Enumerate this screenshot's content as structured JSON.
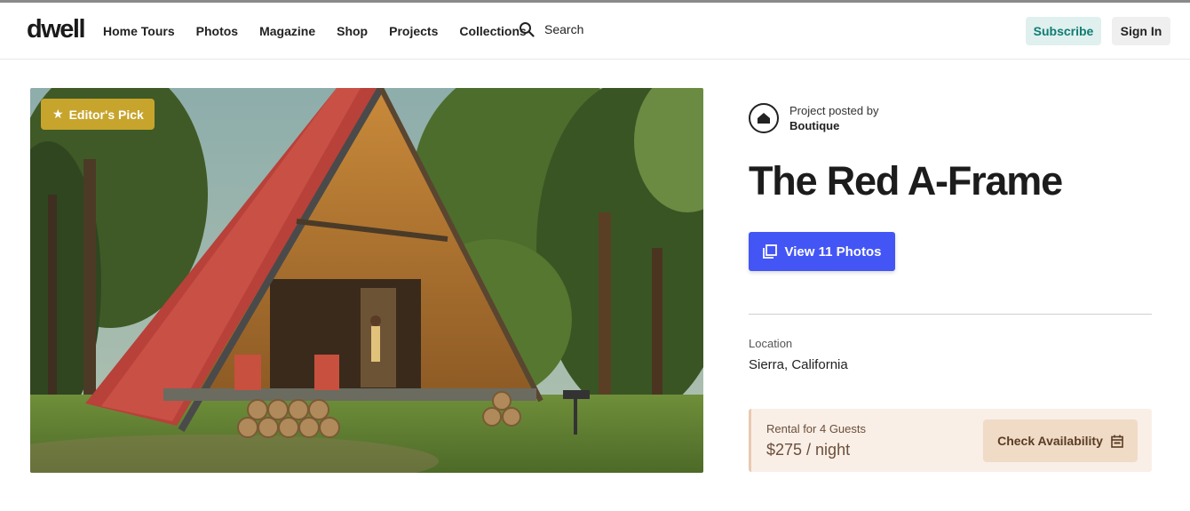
{
  "header": {
    "logo": "dwell",
    "nav": [
      "Home Tours",
      "Photos",
      "Magazine",
      "Shop",
      "Projects",
      "Collections"
    ],
    "search_label": "Search",
    "subscribe_label": "Subscribe",
    "signin_label": "Sign In"
  },
  "hero": {
    "badge_label": "Editor's Pick",
    "badge_icon": "star-icon",
    "image_subject": "red-a-frame-cabin-photo"
  },
  "project": {
    "posted_by_label": "Project posted by",
    "posted_by_name": "Boutique",
    "title": "The Red A-Frame",
    "view_photos_label": "View 11 Photos",
    "location_label": "Location",
    "location_value": "Sierra, California"
  },
  "rental": {
    "guests_label": "Rental for 4 Guests",
    "price": "$275 / night",
    "cta_label": "Check Availability",
    "cta_icon": "calendar-icon"
  },
  "colors": {
    "accent_blue": "#4356f5",
    "badge_gold": "#c7a42c",
    "subscribe_bg": "#dff0ee",
    "subscribe_text": "#0f7c72",
    "rental_bg": "#f9efe7"
  }
}
